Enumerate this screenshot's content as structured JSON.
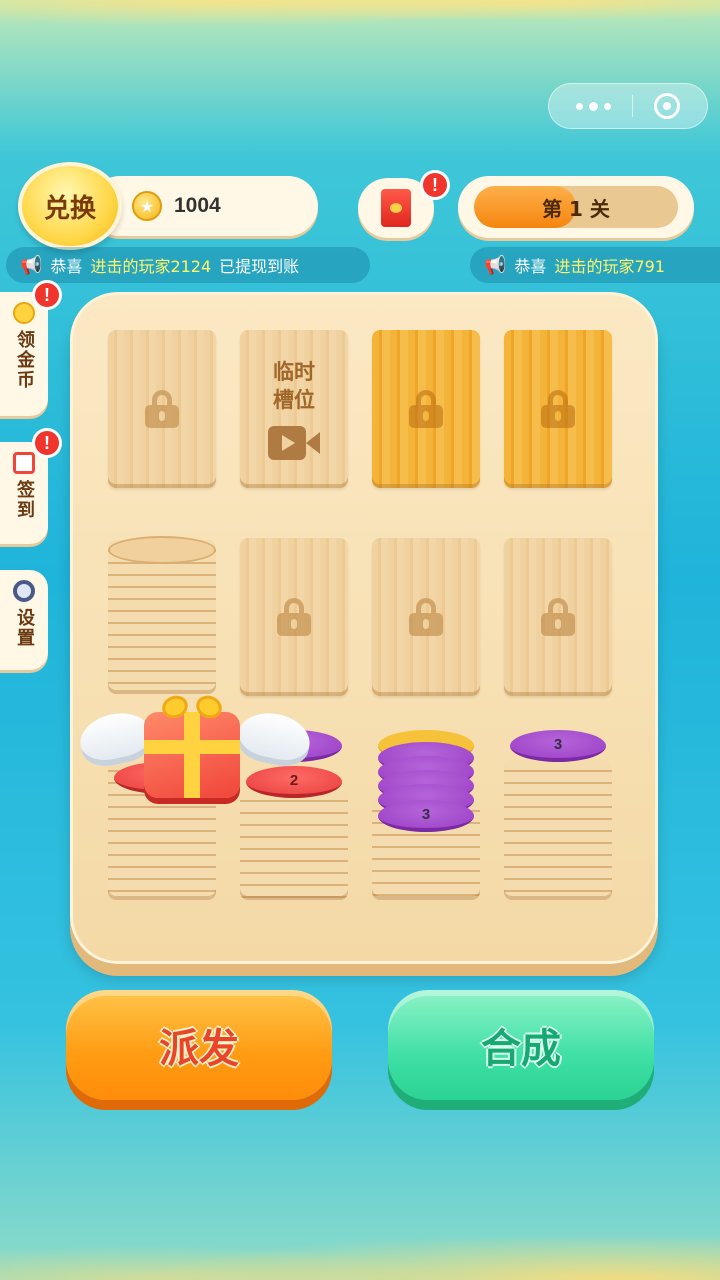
{
  "header": {
    "exchange_label": "兑换",
    "coins": "1004",
    "level_text": "第 1 关",
    "level_progress": 0.5,
    "redpacket_badge": "!"
  },
  "tickers": [
    {
      "prefix": "恭喜",
      "highlight": "进击的玩家2124",
      "suffix": "已提现到账"
    },
    {
      "prefix": "恭喜",
      "highlight": "进击的玩家791",
      "suffix": ""
    }
  ],
  "side_menu": [
    {
      "label": "领金币",
      "badge": "!",
      "icon": "coin-icon"
    },
    {
      "label": "签到",
      "badge": "!",
      "icon": "calendar-icon"
    },
    {
      "label": "设置",
      "badge": "",
      "icon": "gear-icon"
    }
  ],
  "board": {
    "temp_slot_label": "临时\n槽位",
    "chips": {
      "col2": "2",
      "col3": "3",
      "col4": "3"
    }
  },
  "buttons": {
    "deal": "派发",
    "merge": "合成"
  },
  "colors": {
    "chip_purple": "#9b3fc6",
    "chip_red": "#e8403e",
    "chip_yellow": "#f5c23a",
    "deal_button": "#ff9b12",
    "merge_button": "#3fe0a5"
  }
}
